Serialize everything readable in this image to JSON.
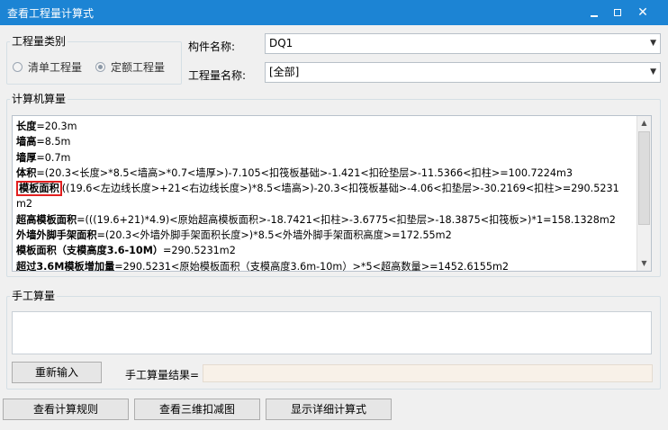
{
  "window": {
    "title": "查看工程量计算式",
    "controls": {
      "minimize": "minimize-icon",
      "maximize": "maximize-icon",
      "close": "close-icon"
    }
  },
  "quantity_type": {
    "label": "工程量类别",
    "options": [
      {
        "label": "清单工程量",
        "checked": false
      },
      {
        "label": "定额工程量",
        "checked": true
      }
    ]
  },
  "component_name": {
    "label": "构件名称:",
    "value": "DQ1"
  },
  "quantity_name": {
    "label": "工程量名称:",
    "value": "[全部]"
  },
  "computer_calc": {
    "label": "计算机算量",
    "lines": [
      {
        "head": "长度",
        "rest": "=20.3m"
      },
      {
        "head": "墙高",
        "rest": "=8.5m"
      },
      {
        "head": "墙厚",
        "rest": "=0.7m"
      },
      {
        "head": "体积",
        "rest": "=(20.3<长度>*8.5<墙高>*0.7<墙厚>)-7.105<扣筏板基础>-1.421<扣砼垫层>-11.5366<扣柱>=100.7224m3"
      },
      {
        "head": "模板面积",
        "rest": "((19.6<左边线长度>+21<右边线长度>)*8.5<墙高>)-20.3<扣筏板基础>-4.06<扣垫层>-30.2169<扣柱>=290.5231"
      },
      {
        "head": "",
        "rest": "m2"
      },
      {
        "head": "超高模板面积",
        "rest": "=(((19.6+21)*4.9)<原始超高模板面积>-18.7421<扣柱>-3.6775<扣垫层>-18.3875<扣筏板>)*1=158.1328m2"
      },
      {
        "head": "外墙外脚手架面积",
        "rest": "=(20.3<外墙外脚手架面积长度>)*8.5<外墙外脚手架面积高度>=172.55m2"
      },
      {
        "head": "模板面积（支模高度3.6-10M）",
        "rest": "=290.5231m2"
      },
      {
        "head": "超过3.6M模板增加量",
        "rest": "=290.5231<原始模板面积（支模高度3.6m-10m）>*5<超高数量>=1452.6155m2"
      }
    ]
  },
  "manual_calc": {
    "label": "手工算量",
    "value": "",
    "reenter_button": "重新输入",
    "result_label": "手工算量结果=",
    "result_value": ""
  },
  "footer": {
    "view_rules": "查看计算规则",
    "view_3d": "查看三维扣减图",
    "show_detail": "显示详细计算式"
  },
  "colors": {
    "titlebar": "#1c84d4",
    "highlight": "#e21f1f",
    "result_field": "#f8f1e8"
  }
}
